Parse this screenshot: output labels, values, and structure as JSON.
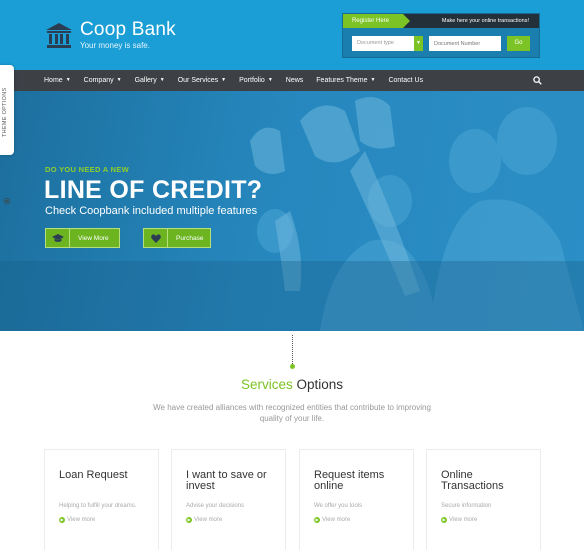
{
  "brand": {
    "name": "Coop Bank",
    "tagline": "Your money is safe."
  },
  "transactions": {
    "register_label": "Register Here",
    "message": "Make here your online transactions!",
    "doc_type_placeholder": "Document type",
    "doc_number_placeholder": "Document Number",
    "go_label": "Go"
  },
  "nav": {
    "items": [
      {
        "label": "Home",
        "has_caret": true
      },
      {
        "label": "Company",
        "has_caret": true
      },
      {
        "label": "Gallery",
        "has_caret": true
      },
      {
        "label": "Our Services",
        "has_caret": true
      },
      {
        "label": "Portfolio",
        "has_caret": true
      },
      {
        "label": "News",
        "has_caret": false
      },
      {
        "label": "Features Theme",
        "has_caret": true
      },
      {
        "label": "Contact Us",
        "has_caret": false
      }
    ]
  },
  "theme_tab": {
    "label": "THEME OPTIONS"
  },
  "hero": {
    "kicker": "DO YOU NEED A NEW",
    "title": "LINE OF CREDIT?",
    "subtitle": "Check Coopbank included multiple features",
    "view_more_label": "View More",
    "purchase_label": "Purchase"
  },
  "services": {
    "title_accent": "Services",
    "title_rest": " Options",
    "description": "We have created alliances with recognized entities that contribute to improving quality of your life.",
    "cards": [
      {
        "title": "Loan Request",
        "desc": "Helping to fulfill your dreams.",
        "link": "View more"
      },
      {
        "title": "I want to save or invest",
        "desc": "Advise your decisions",
        "link": "View more"
      },
      {
        "title": "Request items online",
        "desc": "We offer you tools",
        "link": "View more"
      },
      {
        "title": "Online Transactions",
        "desc": "Secure information",
        "link": "View more"
      }
    ]
  },
  "colors": {
    "header_blue": "#1b9ed6",
    "accent_green": "#7cc325",
    "nav_dark": "#3d4146"
  }
}
